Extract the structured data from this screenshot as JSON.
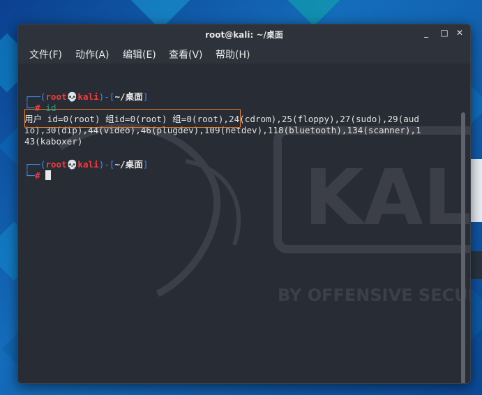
{
  "window": {
    "title": "root@kali: ~/桌面",
    "minimize_glyph": "_",
    "maximize_glyph": "□",
    "close_glyph": "✕"
  },
  "menu": {
    "file": "文件(F)",
    "edit_action": "动作(A)",
    "edit": "编辑(E)",
    "view": "查看(V)",
    "help": "帮助(H)"
  },
  "terminal": {
    "prompt1": {
      "corner_top": "┌──(",
      "user": "root",
      "skull": "💀",
      "host": "kali",
      "mid": ")-[",
      "path": "~/桌面",
      "end": "]",
      "corner_bottom": "└─",
      "hash": "#",
      "command": "id"
    },
    "output": [
      "用户 id=0(root) 组id=0(root) 组=0(root),24(cdrom),25(floppy),27(sudo),29(aud",
      "io),30(dip),44(video),46(plugdev),109(netdev),118(bluetooth),134(scanner),1",
      "43(kaboxer)"
    ],
    "prompt2": {
      "corner_top": "┌──(",
      "user": "root",
      "skull": "💀",
      "host": "kali",
      "mid": ")-[",
      "path": "~/桌面",
      "end": "]",
      "corner_bottom": "└─",
      "hash": "#"
    }
  },
  "desktop": {
    "watermark_word": "KALI",
    "watermark_sub": "BY OFFENSIVE SECURITY"
  },
  "colors": {
    "accent_highlight": "#f0822e",
    "prompt_blue": "#3f8cf0",
    "prompt_red": "#f33b3b",
    "terminal_bg": "#282c34"
  }
}
